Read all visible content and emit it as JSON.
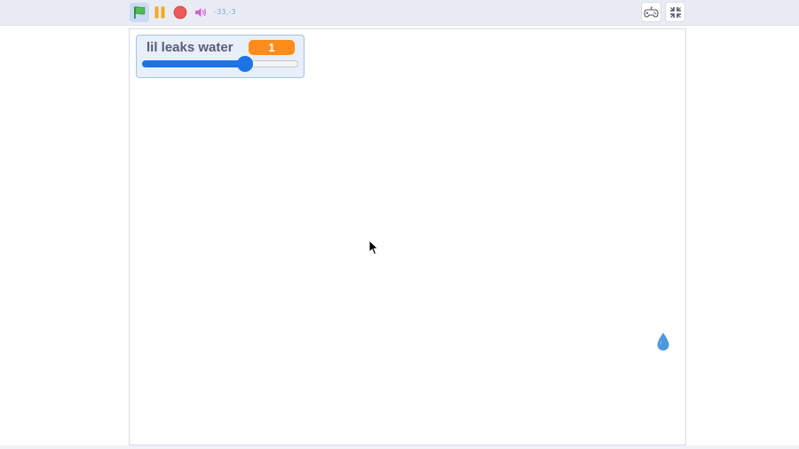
{
  "toolbar": {
    "coords_text": "-33,-3",
    "icons": {
      "green_flag": "green-flag-icon",
      "pause": "pause-icon",
      "stop": "stop-icon",
      "sound": "sound-icon",
      "gamepad": "gamepad-icon",
      "fullscreen": "exit-fullscreen-icon"
    }
  },
  "monitor": {
    "label": "lil leaks water",
    "value": "1",
    "slider_fraction": 0.66
  },
  "colors": {
    "flag_green": "#4cbf56",
    "pause_orange": "#f7a823",
    "stop_red": "#ec5959",
    "sound_magenta": "#cf63cf",
    "monitor_orange": "#ff8c1a",
    "slider_blue": "#1e72e8",
    "drop_blue": "#4d97e0"
  },
  "stage": {
    "sprite": "water-drop-icon"
  }
}
